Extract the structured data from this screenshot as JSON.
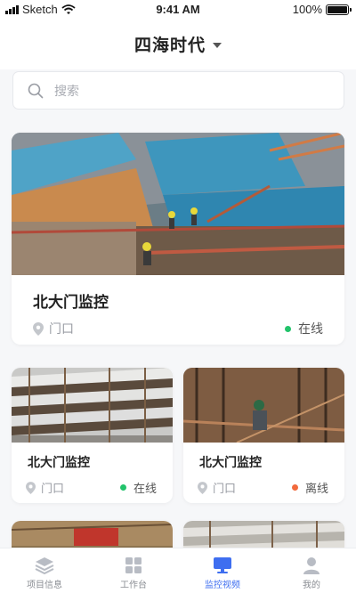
{
  "status_bar": {
    "carrier": "Sketch",
    "time": "9:41 AM",
    "battery": "100%"
  },
  "header": {
    "title": "四海时代"
  },
  "search": {
    "placeholder": "搜索"
  },
  "cameras": [
    {
      "name": "北大门监控",
      "location": "门口",
      "status": "在线",
      "status_color": "#22c36b"
    },
    {
      "name": "北大门监控",
      "location": "门口",
      "status": "在线",
      "status_color": "#22c36b"
    },
    {
      "name": "北大门监控",
      "location": "门口",
      "status": "离线",
      "status_color": "#f26a3d"
    }
  ],
  "tabbar": {
    "items": [
      {
        "label": "项目信息",
        "icon": "layers-icon",
        "active": false
      },
      {
        "label": "工作台",
        "icon": "grid-icon",
        "active": false
      },
      {
        "label": "监控视频",
        "icon": "monitor-icon",
        "active": true
      },
      {
        "label": "我的",
        "icon": "user-icon",
        "active": false
      }
    ],
    "active_color": "#3e6ef0",
    "inactive_color": "#b8bcc4"
  }
}
